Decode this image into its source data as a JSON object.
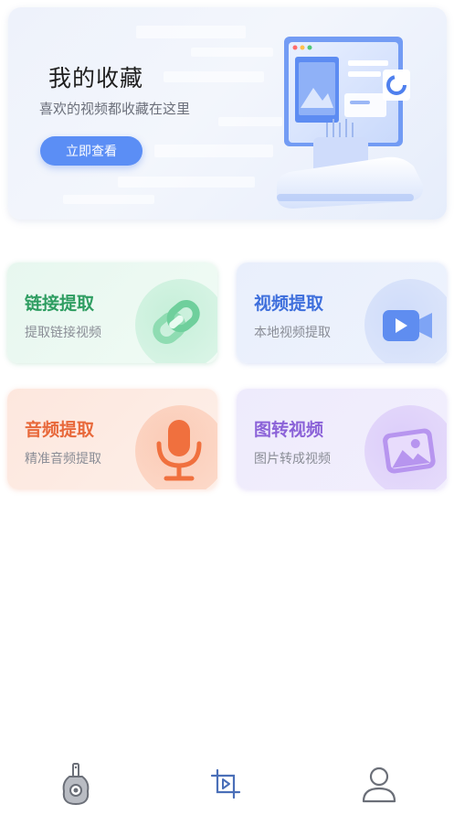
{
  "banner": {
    "title": "我的收藏",
    "subtitle": "喜欢的视频都收藏在这里",
    "button_label": "立即查看",
    "accent": "#5b8ef5"
  },
  "cards": [
    {
      "title": "链接提取",
      "subtitle": "提取链接视频",
      "icon": "link-icon",
      "color": "#2e9d61"
    },
    {
      "title": "视频提取",
      "subtitle": "本地视频提取",
      "icon": "video-icon",
      "color": "#3e6fdc"
    },
    {
      "title": "音频提取",
      "subtitle": "精准音频提取",
      "icon": "microphone-icon",
      "color": "#e8683a"
    },
    {
      "title": "图转视频",
      "subtitle": "图片转成视频",
      "icon": "image-icon",
      "color": "#8b62d8"
    }
  ],
  "nav": {
    "items": [
      {
        "icon": "guitar-icon"
      },
      {
        "icon": "crop-play-icon"
      },
      {
        "icon": "user-icon"
      }
    ]
  }
}
